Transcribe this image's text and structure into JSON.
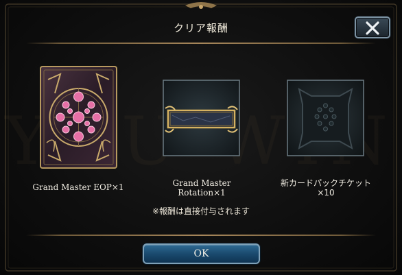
{
  "dialog": {
    "title": "クリア報酬",
    "background_text": "YOU WIN"
  },
  "rewards": [
    {
      "label": "Grand Master EOP×1"
    },
    {
      "label_line1": "Grand Master",
      "label_line2": "Rotation×1"
    },
    {
      "label_line1": "新カードパックチケット",
      "label_line2": "×10"
    }
  ],
  "note": "※報酬は直接付与されます",
  "buttons": {
    "ok": "OK"
  },
  "colors": {
    "accent_gold": "#a6865a",
    "button_blue": "#1a4a6e",
    "card_pink": "#e66fa6"
  }
}
